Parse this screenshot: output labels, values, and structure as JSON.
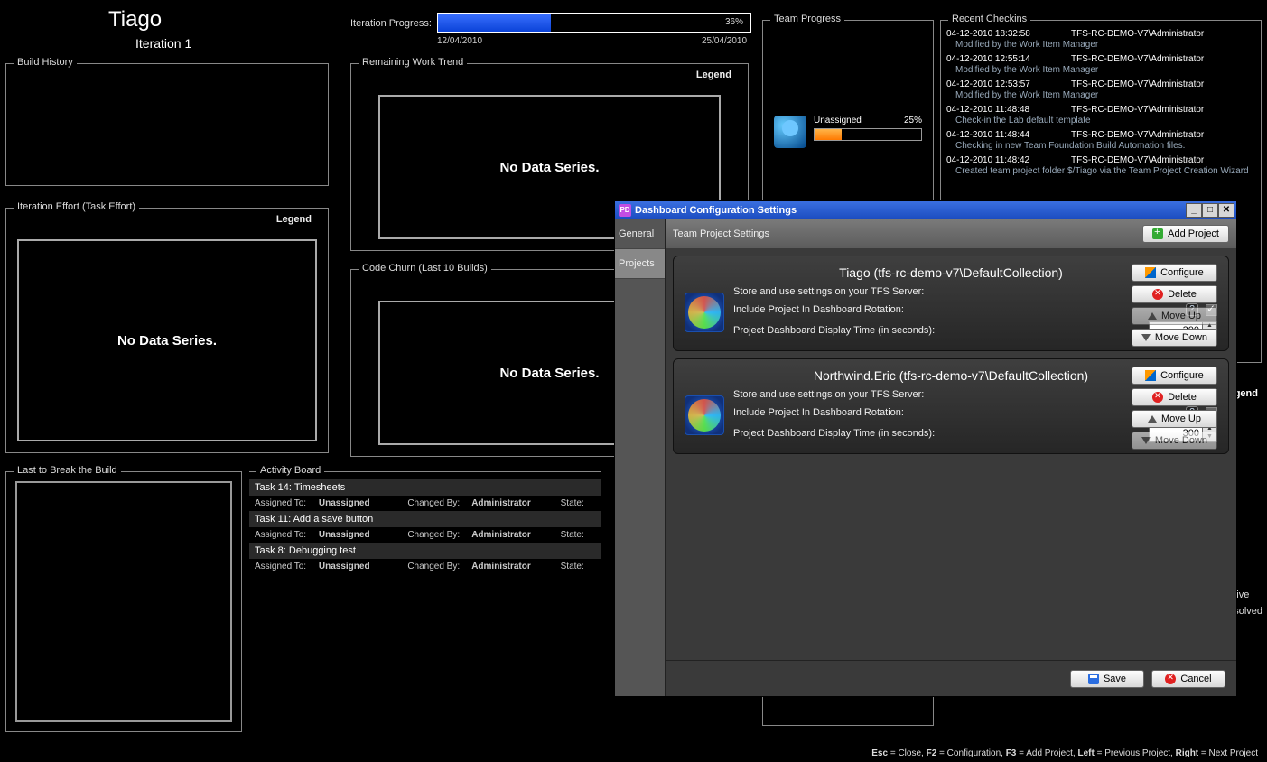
{
  "header": {
    "name": "Tiago",
    "iteration": "Iteration 1"
  },
  "iterProgress": {
    "label": "Iteration Progress:",
    "pct": "36%",
    "pctVal": 36,
    "start": "12/04/2010",
    "end": "25/04/2010"
  },
  "panels": {
    "build": "Build History",
    "iter": "Iteration Effort (Task Effort)",
    "last": "Last to Break the Build",
    "activity": "Activity Board",
    "remain": "Remaining Work Trend",
    "churn": "Code Churn (Last 10 Builds)",
    "team": "Team Progress",
    "recent": "Recent Checkins"
  },
  "legend": "Legend",
  "noData": "No Data Series.",
  "team": {
    "name": "Unassigned",
    "pct": "25%",
    "pctVal": 25
  },
  "activity": {
    "labels": {
      "assigned": "Assigned To:",
      "changed": "Changed By:",
      "state": "State:"
    },
    "items": [
      {
        "title": "Task 14: Timesheets",
        "assigned": "Unassigned",
        "changedBy": "Administrator"
      },
      {
        "title": "Task 11: Add a save button",
        "assigned": "Unassigned",
        "changedBy": "Administrator"
      },
      {
        "title": "Task 8: Debugging test",
        "assigned": "Unassigned",
        "changedBy": "Administrator"
      }
    ]
  },
  "checkins": [
    {
      "time": "04-12-2010 18:32:58",
      "who": "TFS-RC-DEMO-V7\\Administrator",
      "msg": "Modified by the Work Item Manager"
    },
    {
      "time": "04-12-2010 12:55:14",
      "who": "TFS-RC-DEMO-V7\\Administrator",
      "msg": "Modified by the Work Item Manager"
    },
    {
      "time": "04-12-2010 12:53:57",
      "who": "TFS-RC-DEMO-V7\\Administrator",
      "msg": "Modified by the Work Item Manager"
    },
    {
      "time": "04-12-2010 11:48:48",
      "who": "TFS-RC-DEMO-V7\\Administrator",
      "msg": "Check-in the Lab default template"
    },
    {
      "time": "04-12-2010 11:48:44",
      "who": "TFS-RC-DEMO-V7\\Administrator",
      "msg": "Checking in new Team Foundation Build Automation files."
    },
    {
      "time": "04-12-2010 11:48:42",
      "who": "TFS-RC-DEMO-V7\\Administrator",
      "msg": "Created team project folder $/Tiago via the Team Project Creation Wizard"
    }
  ],
  "hiddenLegend": [
    "tive",
    "solved"
  ],
  "dialog": {
    "title": "Dashboard Configuration Settings",
    "tabs": {
      "general": "General",
      "projects": "Projects"
    },
    "subheader": "Team Project Settings",
    "addProject": "Add Project",
    "labels": {
      "store": "Store and use settings on your TFS Server:",
      "include": "Include Project In Dashboard Rotation:",
      "displayTime": "Project Dashboard Display Time (in seconds):"
    },
    "buttons": {
      "configure": "Configure",
      "delete": "Delete",
      "moveUp": "Move Up",
      "moveDown": "Move Down",
      "save": "Save",
      "cancel": "Cancel"
    },
    "projects": [
      {
        "title": "Tiago (tfs-rc-demo-v7\\DefaultCollection)",
        "store": true,
        "include": true,
        "time": "300",
        "upDisabled": true,
        "downDisabled": false
      },
      {
        "title": "Northwind.Eric (tfs-rc-demo-v7\\DefaultCollection)",
        "store": true,
        "include": false,
        "time": "300",
        "upDisabled": false,
        "downDisabled": true
      }
    ]
  },
  "footer": {
    "esc": "Esc",
    "escT": " = Close, ",
    "f2": "F2",
    "f2T": " = Configuration, ",
    "f3": "F3",
    "f3T": " = Add Project, ",
    "left": "Left",
    "leftT": " = Previous Project, ",
    "right": "Right",
    "rightT": " = Next Project"
  }
}
